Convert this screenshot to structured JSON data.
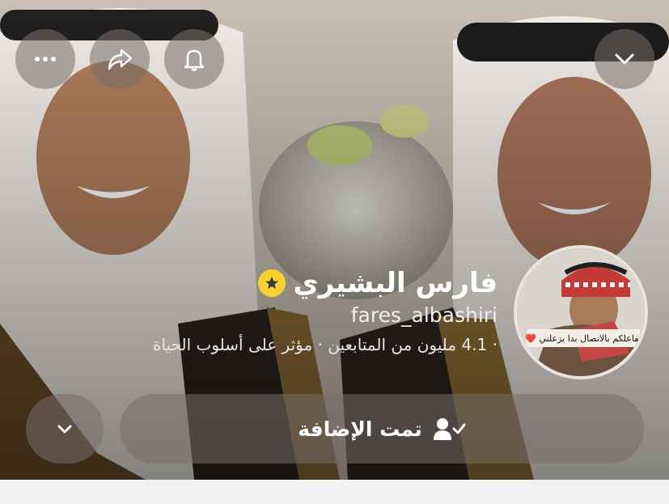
{
  "header": {
    "icons": [
      "more-icon",
      "share-icon",
      "bell-icon",
      "chevron-down-icon"
    ]
  },
  "profile": {
    "display_name": "فارس البشيري",
    "username": "fares_albashiri",
    "bio": "· 4.1 مليون من المتابعين · مؤثر على أسلوب الحياة",
    "badge_icon": "star-badge-icon",
    "avatar_caption": "تفاعلكم بالاتصال بدا يزعلني ❤️"
  },
  "actions": {
    "added_label": "تمت الإضافة",
    "added_icon": "person-check-icon",
    "expand_icon": "chevron-down-icon"
  },
  "colors": {
    "badge": "#f7d331",
    "button_bg": "rgba(120,110,105,0.55)"
  }
}
